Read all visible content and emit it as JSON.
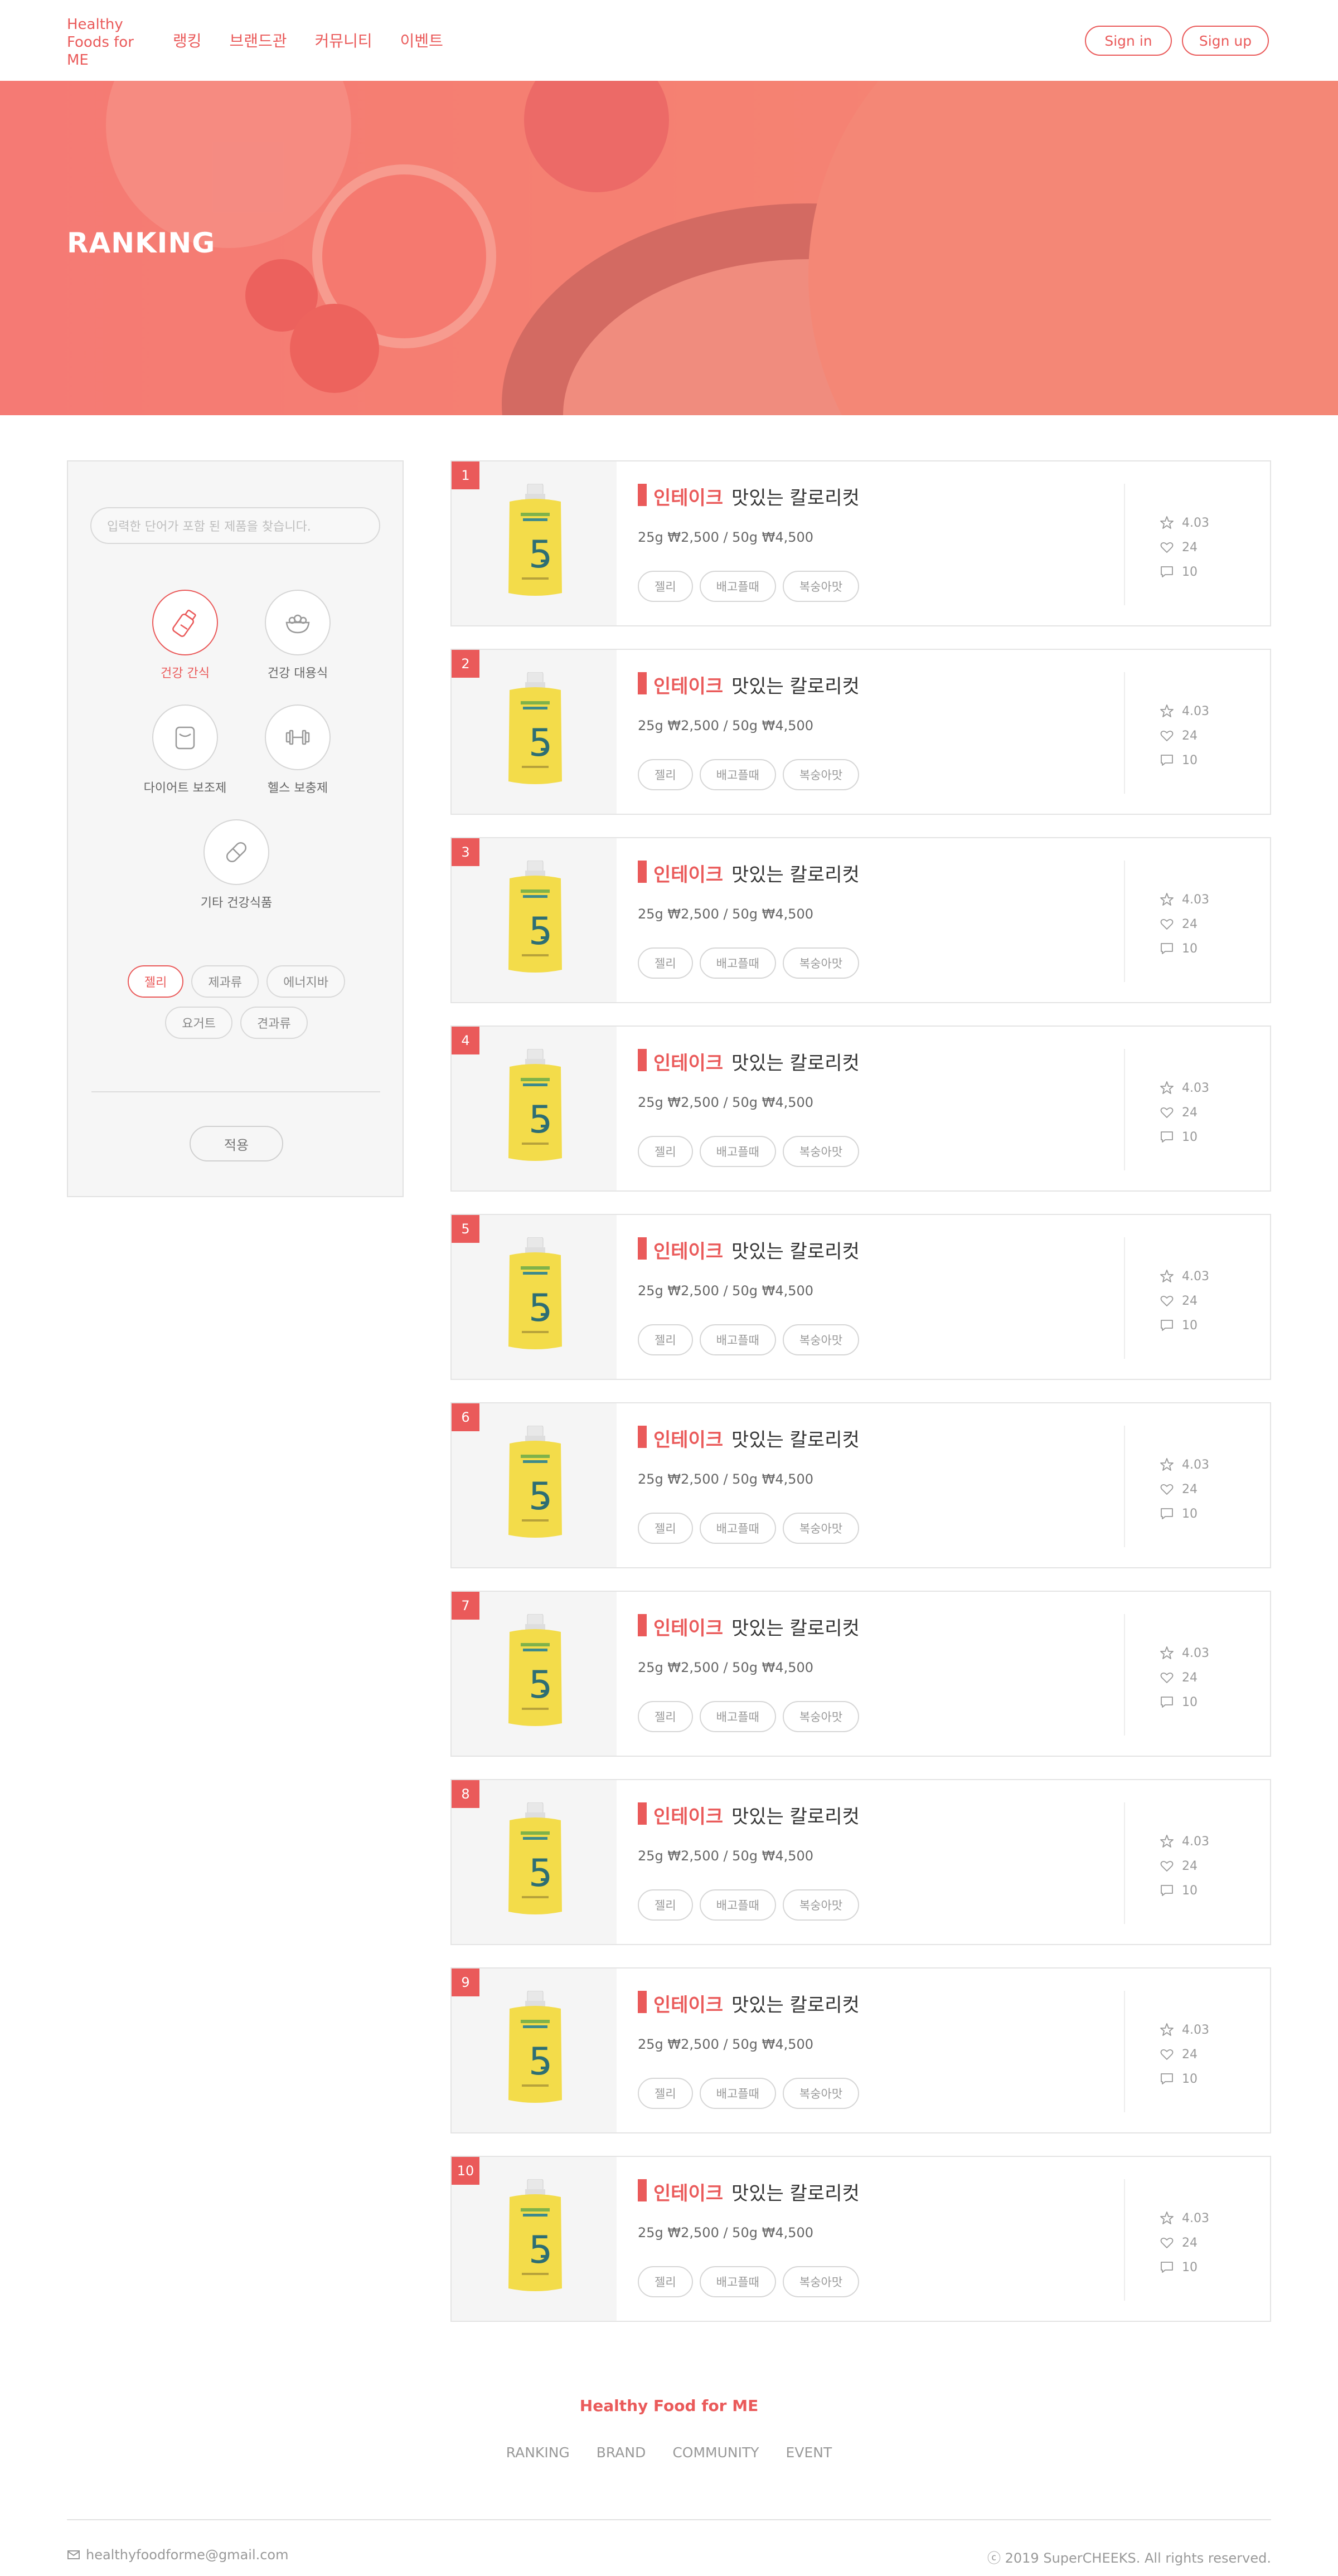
{
  "header": {
    "logo": "Healthy Foods for ME",
    "nav": [
      "랭킹",
      "브랜드관",
      "커뮤니티",
      "이벤트"
    ],
    "sign_in": "Sign in",
    "sign_up": "Sign up"
  },
  "hero": {
    "title": "RANKING"
  },
  "sidebar": {
    "search_placeholder": "입력한 단어가 포함 된 제품을 찾습니다.",
    "categories": [
      {
        "label": "건강 간식",
        "icon": "snack-bottle-icon",
        "active": true
      },
      {
        "label": "건강 대용식",
        "icon": "meal-bowl-icon",
        "active": false
      },
      {
        "label": "다이어트 보조제",
        "icon": "supplement-jar-icon",
        "active": false
      },
      {
        "label": "헬스 보충제",
        "icon": "dumbbell-icon",
        "active": false
      },
      {
        "label": "기타 건강식품",
        "icon": "pill-icon",
        "active": false
      }
    ],
    "chips": [
      {
        "label": "젤리",
        "active": true
      },
      {
        "label": "제과류",
        "active": false
      },
      {
        "label": "에너지바",
        "active": false
      },
      {
        "label": "요거트",
        "active": false
      },
      {
        "label": "견과류",
        "active": false
      }
    ],
    "apply_label": "적용"
  },
  "products": [
    {
      "rank": "1",
      "brand": "인테이크",
      "name": "맛있는 칼로리컷",
      "price": "25g ₩2,500 / 50g ₩4,500",
      "tags": [
        "젤리",
        "배고플때",
        "복숭아맛"
      ],
      "rating": "4.03",
      "likes": "24",
      "comments": "10"
    },
    {
      "rank": "2",
      "brand": "인테이크",
      "name": "맛있는 칼로리컷",
      "price": "25g ₩2,500 / 50g ₩4,500",
      "tags": [
        "젤리",
        "배고플때",
        "복숭아맛"
      ],
      "rating": "4.03",
      "likes": "24",
      "comments": "10"
    },
    {
      "rank": "3",
      "brand": "인테이크",
      "name": "맛있는 칼로리컷",
      "price": "25g ₩2,500 / 50g ₩4,500",
      "tags": [
        "젤리",
        "배고플때",
        "복숭아맛"
      ],
      "rating": "4.03",
      "likes": "24",
      "comments": "10"
    },
    {
      "rank": "4",
      "brand": "인테이크",
      "name": "맛있는 칼로리컷",
      "price": "25g ₩2,500 / 50g ₩4,500",
      "tags": [
        "젤리",
        "배고플때",
        "복숭아맛"
      ],
      "rating": "4.03",
      "likes": "24",
      "comments": "10"
    },
    {
      "rank": "5",
      "brand": "인테이크",
      "name": "맛있는 칼로리컷",
      "price": "25g ₩2,500 / 50g ₩4,500",
      "tags": [
        "젤리",
        "배고플때",
        "복숭아맛"
      ],
      "rating": "4.03",
      "likes": "24",
      "comments": "10"
    },
    {
      "rank": "6",
      "brand": "인테이크",
      "name": "맛있는 칼로리컷",
      "price": "25g ₩2,500 / 50g ₩4,500",
      "tags": [
        "젤리",
        "배고플때",
        "복숭아맛"
      ],
      "rating": "4.03",
      "likes": "24",
      "comments": "10"
    },
    {
      "rank": "7",
      "brand": "인테이크",
      "name": "맛있는 칼로리컷",
      "price": "25g ₩2,500 / 50g ₩4,500",
      "tags": [
        "젤리",
        "배고플때",
        "복숭아맛"
      ],
      "rating": "4.03",
      "likes": "24",
      "comments": "10"
    },
    {
      "rank": "8",
      "brand": "인테이크",
      "name": "맛있는 칼로리컷",
      "price": "25g ₩2,500 / 50g ₩4,500",
      "tags": [
        "젤리",
        "배고플때",
        "복숭아맛"
      ],
      "rating": "4.03",
      "likes": "24",
      "comments": "10"
    },
    {
      "rank": "9",
      "brand": "인테이크",
      "name": "맛있는 칼로리컷",
      "price": "25g ₩2,500 / 50g ₩4,500",
      "tags": [
        "젤리",
        "배고플때",
        "복숭아맛"
      ],
      "rating": "4.03",
      "likes": "24",
      "comments": "10"
    },
    {
      "rank": "10",
      "brand": "인테이크",
      "name": "맛있는 칼로리컷",
      "price": "25g ₩2,500 / 50g ₩4,500",
      "tags": [
        "젤리",
        "배고플때",
        "복숭아맛"
      ],
      "rating": "4.03",
      "likes": "24",
      "comments": "10"
    }
  ],
  "footer": {
    "brand": "Healthy Food for ME",
    "nav": [
      "RANKING",
      "BRAND",
      "COMMUNITY",
      "EVENT"
    ],
    "email": "healthyfoodforme@gmail.com",
    "copyright": "ⓒ 2019 SuperCHEEKS. All rights reserved."
  },
  "colors": {
    "accent": "#ea5a5a",
    "pouch": "#f3dc4a"
  }
}
